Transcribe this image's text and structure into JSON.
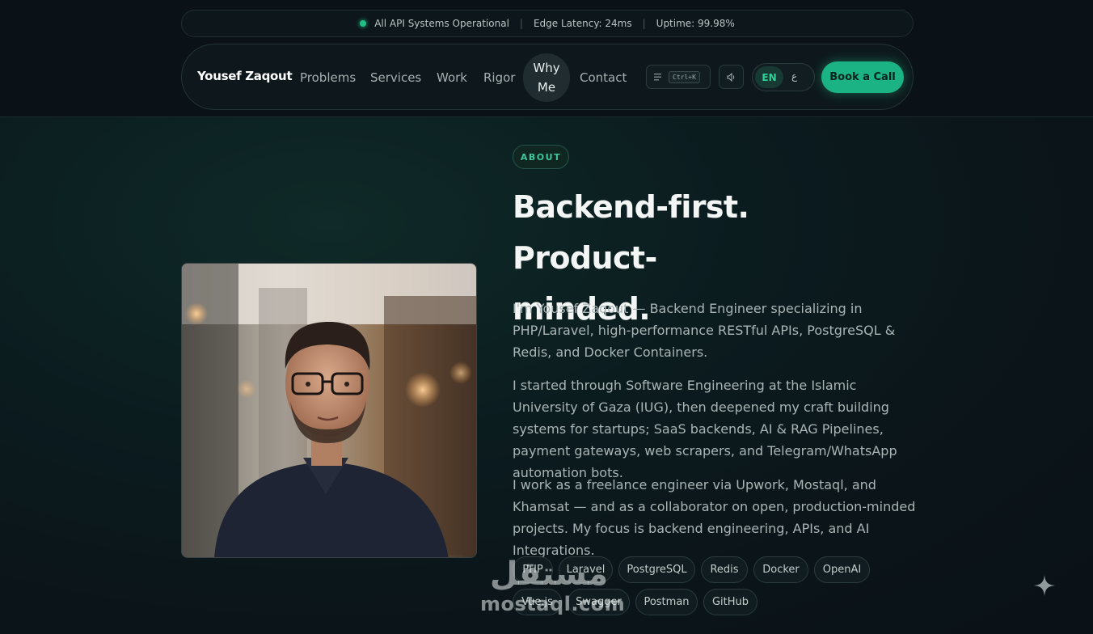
{
  "status_bar": {
    "operational": "All API Systems Operational",
    "latency": "Edge Latency: 24ms",
    "uptime": "Uptime: 99.98%",
    "separator": "|"
  },
  "nav": {
    "brand": "Yousef Zaqout",
    "links": [
      "Problems",
      "Services",
      "Work",
      "Rigor",
      "Why\nMe",
      "Contact"
    ],
    "search_shortcut": "Ctrl+K",
    "lang_en": "EN",
    "lang_ar": "ع",
    "cta": "Book a Call"
  },
  "about": {
    "badge": "ABOUT",
    "headline_line1": "Backend-first. Product-",
    "headline_line2": "minded.",
    "paragraphs": [
      "I'm Yousef Zaqout — Backend Engineer specializing in PHP/Laravel, high-performance RESTful APIs, PostgreSQL & Redis, and Docker Containers.",
      "I started through Software Engineering at the Islamic University of Gaza (IUG), then deepened my craft building systems for startups; SaaS backends, AI & RAG Pipelines, payment gateways, web scrapers, and Telegram/WhatsApp automation bots.",
      "I work as a freelance engineer via Upwork, Mostaql, and Khamsat — and as a collaborator on open, production-minded projects. My focus is backend engineering, APIs, and AI Integrations."
    ],
    "skills_row1": [
      "PHP",
      "Laravel",
      "PostgreSQL",
      "Redis",
      "Docker",
      "OpenAI"
    ],
    "skills_row2": [
      "Vue.js",
      "Swagger",
      "Postman",
      "GitHub"
    ]
  },
  "watermark": {
    "arabic": "مستقل",
    "latin": "mostaql.com"
  },
  "colors": {
    "accent": "#1bb284",
    "status_dot": "#1fbf84",
    "background": "#0b1419"
  },
  "icons": {
    "search": "menu-lines-icon",
    "sound": "speaker-icon",
    "sparkle": "sparkle-icon"
  }
}
